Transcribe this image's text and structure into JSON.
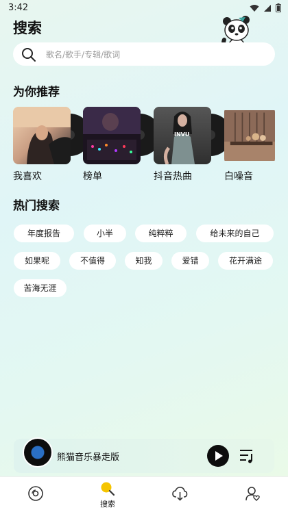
{
  "status": {
    "time": "3:42"
  },
  "header": {
    "title": "搜索"
  },
  "search": {
    "placeholder": "歌名/歌手/专辑/歌词"
  },
  "recommend": {
    "title": "为你推荐",
    "items": [
      {
        "label": "我喜欢"
      },
      {
        "label": "榜单"
      },
      {
        "label": "抖音热曲",
        "cover_text": "INVU"
      },
      {
        "label": "白噪音"
      }
    ]
  },
  "hot": {
    "title": "热门搜索",
    "tags": [
      "年度报告",
      "小半",
      "纯粹粹",
      "给未来的自己",
      "如果呢",
      "不值得",
      "知我",
      "爱错",
      "花开满途",
      "苦海无涯"
    ]
  },
  "player": {
    "title": "熊猫音乐暴走版"
  },
  "nav": {
    "items": [
      {
        "icon": "disc-icon",
        "label": ""
      },
      {
        "icon": "search-icon",
        "label": "搜索"
      },
      {
        "icon": "cloud-download-icon",
        "label": ""
      },
      {
        "icon": "user-heart-icon",
        "label": ""
      }
    ]
  },
  "colors": {
    "accent": "#f5c400",
    "text": "#111111",
    "placeholder": "#9a9a9a"
  }
}
